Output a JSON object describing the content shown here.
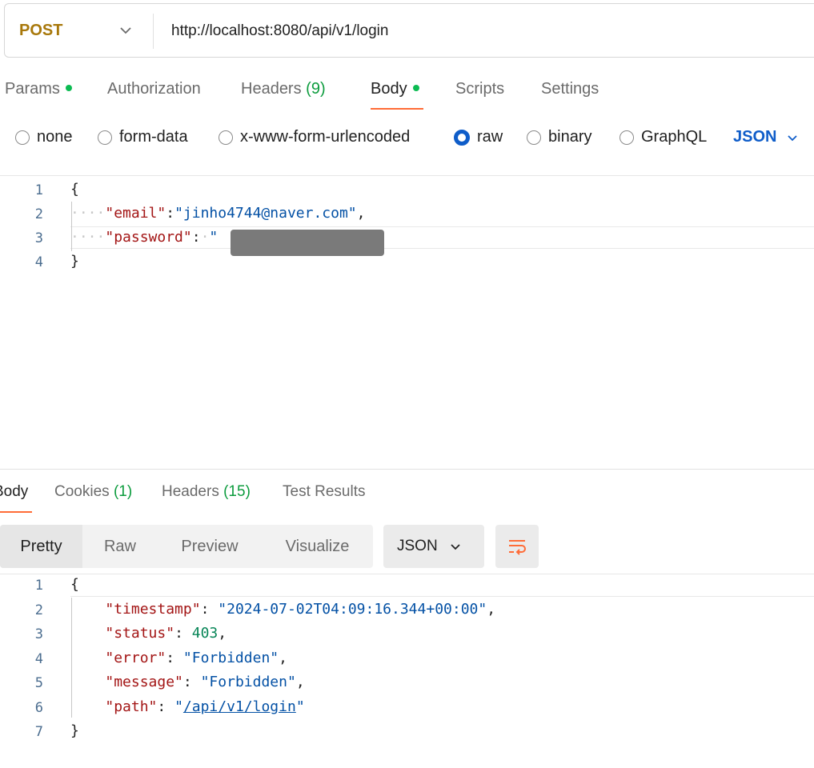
{
  "request": {
    "method": "POST",
    "url": "http://localhost:8080/api/v1/login"
  },
  "request_tabs": [
    {
      "label": "Params",
      "dot": true
    },
    {
      "label": "Authorization"
    },
    {
      "label": "Headers",
      "count": "(9)"
    },
    {
      "label": "Body",
      "dot": true,
      "active": true
    },
    {
      "label": "Scripts"
    },
    {
      "label": "Settings"
    }
  ],
  "body_types": [
    {
      "label": "none",
      "checked": false
    },
    {
      "label": "form-data",
      "checked": false
    },
    {
      "label": "x-www-form-urlencoded",
      "checked": false
    },
    {
      "label": "raw",
      "checked": true
    },
    {
      "label": "binary",
      "checked": false
    },
    {
      "label": "GraphQL",
      "checked": false
    }
  ],
  "body_language": "JSON",
  "request_body": {
    "line_numbers": [
      "1",
      "2",
      "3",
      "4"
    ],
    "open_brace": "{",
    "close_brace": "}",
    "email_key": "\"email\"",
    "email_value": "\"jinho4744@naver.com\"",
    "password_key": "\"password\"",
    "password_value_start": "\""
  },
  "response_tabs": [
    {
      "label": "Body",
      "active": true
    },
    {
      "label": "Cookies",
      "count": "(1)"
    },
    {
      "label": "Headers",
      "count": "(15)"
    },
    {
      "label": "Test Results"
    }
  ],
  "view_modes": [
    "Pretty",
    "Raw",
    "Preview",
    "Visualize"
  ],
  "response_format": "JSON",
  "response_body": {
    "line_numbers": [
      "1",
      "2",
      "3",
      "4",
      "5",
      "6",
      "7"
    ],
    "open_brace": "{",
    "close_brace": "}",
    "timestamp_key": "\"timestamp\"",
    "timestamp_value": "\"2024-07-02T04:09:16.344+00:00\"",
    "status_key": "\"status\"",
    "status_value": "403",
    "error_key": "\"error\"",
    "error_value": "\"Forbidden\"",
    "message_key": "\"message\"",
    "message_value": "\"Forbidden\"",
    "path_key": "\"path\"",
    "path_quote": "\"",
    "path_value": "/api/v1/login"
  },
  "colors": {
    "method": "#a8780b",
    "accent": "#ff6c37",
    "radio_checked": "#0f5dc9",
    "dot_green": "#0cbb52"
  },
  "icons": [
    "chevron-down-icon",
    "wrap-lines-icon"
  ]
}
